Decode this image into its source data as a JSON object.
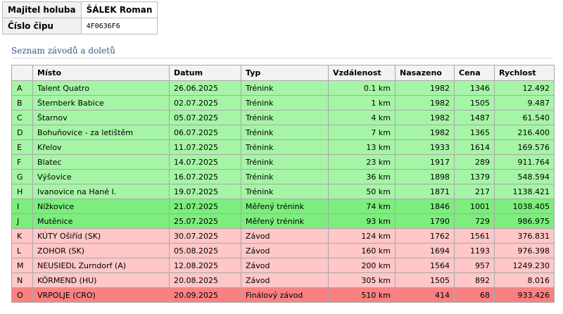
{
  "owner": {
    "owner_label": "Majitel holuba",
    "owner_value": "ŠÁLEK Roman",
    "chip_label": "Číslo čipu",
    "chip_value": "4F0636F6"
  },
  "section": {
    "title": "Seznam závodů a doletů"
  },
  "table": {
    "headers": {
      "letter": "",
      "place": "Místo",
      "date": "Datum",
      "type": "Typ",
      "distance": "Vzdálenost",
      "released": "Nasazeno",
      "prize": "Cena",
      "speed": "Rychlost"
    },
    "rows": [
      {
        "letter": "A",
        "place": "Talent Quatro",
        "date": "26.06.2025",
        "type": "Trénink",
        "distance": "0.1 km",
        "released": "1982",
        "prize": "1346",
        "speed": "12.492",
        "category": "training"
      },
      {
        "letter": "B",
        "place": "Šternberk Babice",
        "date": "02.07.2025",
        "type": "Trénink",
        "distance": "1 km",
        "released": "1982",
        "prize": "1505",
        "speed": "9.487",
        "category": "training"
      },
      {
        "letter": "C",
        "place": "Štarnov",
        "date": "05.07.2025",
        "type": "Trénink",
        "distance": "4 km",
        "released": "1982",
        "prize": "1487",
        "speed": "61.540",
        "category": "training"
      },
      {
        "letter": "D",
        "place": "Bohuňovice - za letištěm",
        "date": "06.07.2025",
        "type": "Trénink",
        "distance": "7 km",
        "released": "1982",
        "prize": "1365",
        "speed": "216.400",
        "category": "training"
      },
      {
        "letter": "E",
        "place": "Křelov",
        "date": "11.07.2025",
        "type": "Trénink",
        "distance": "13 km",
        "released": "1933",
        "prize": "1614",
        "speed": "169.576",
        "category": "training"
      },
      {
        "letter": "F",
        "place": "Blatec",
        "date": "14.07.2025",
        "type": "Trénink",
        "distance": "23 km",
        "released": "1917",
        "prize": "289",
        "speed": "911.764",
        "category": "training"
      },
      {
        "letter": "G",
        "place": "Výšovice",
        "date": "16.07.2025",
        "type": "Trénink",
        "distance": "36 km",
        "released": "1898",
        "prize": "1379",
        "speed": "548.594",
        "category": "training"
      },
      {
        "letter": "H",
        "place": "Ivanovice na Hané I.",
        "date": "19.07.2025",
        "type": "Trénink",
        "distance": "50 km",
        "released": "1871",
        "prize": "217",
        "speed": "1138.421",
        "category": "training"
      },
      {
        "letter": "I",
        "place": "Nížkovice",
        "date": "21.07.2025",
        "type": "Měřený trénink",
        "distance": "74 km",
        "released": "1846",
        "prize": "1001",
        "speed": "1038.405",
        "category": "measured"
      },
      {
        "letter": "J",
        "place": "Mutěnice",
        "date": "25.07.2025",
        "type": "Měřený trénink",
        "distance": "93 km",
        "released": "1790",
        "prize": "729",
        "speed": "986.975",
        "category": "measured"
      },
      {
        "letter": "K",
        "place": "KÚTY Ošiříd (SK)",
        "date": "30.07.2025",
        "type": "Závod",
        "distance": "124 km",
        "released": "1762",
        "prize": "1561",
        "speed": "376.831",
        "category": "race"
      },
      {
        "letter": "L",
        "place": "ZOHOR (SK)",
        "date": "05.08.2025",
        "type": "Závod",
        "distance": "160 km",
        "released": "1694",
        "prize": "1193",
        "speed": "976.398",
        "category": "race"
      },
      {
        "letter": "M",
        "place": "NEUSIEDL Zurndorf (A)",
        "date": "12.08.2025",
        "type": "Závod",
        "distance": "200 km",
        "released": "1564",
        "prize": "957",
        "speed": "1249.230",
        "category": "race"
      },
      {
        "letter": "N",
        "place": "KÖRMEND (HU)",
        "date": "20.08.2025",
        "type": "Závod",
        "distance": "305 km",
        "released": "1505",
        "prize": "892",
        "speed": "8.016",
        "category": "race"
      },
      {
        "letter": "O",
        "place": "VRPOLJE (CRO)",
        "date": "20.09.2025",
        "type": "Finálový závod",
        "distance": "510 km",
        "released": "414",
        "prize": "68",
        "speed": "933.426",
        "category": "final"
      }
    ]
  },
  "colors": {
    "training": "#a6f5a6",
    "measured": "#7ded7d",
    "race": "#ffc7c7",
    "final": "#fa8181",
    "section_title": "#2f5b8e"
  }
}
